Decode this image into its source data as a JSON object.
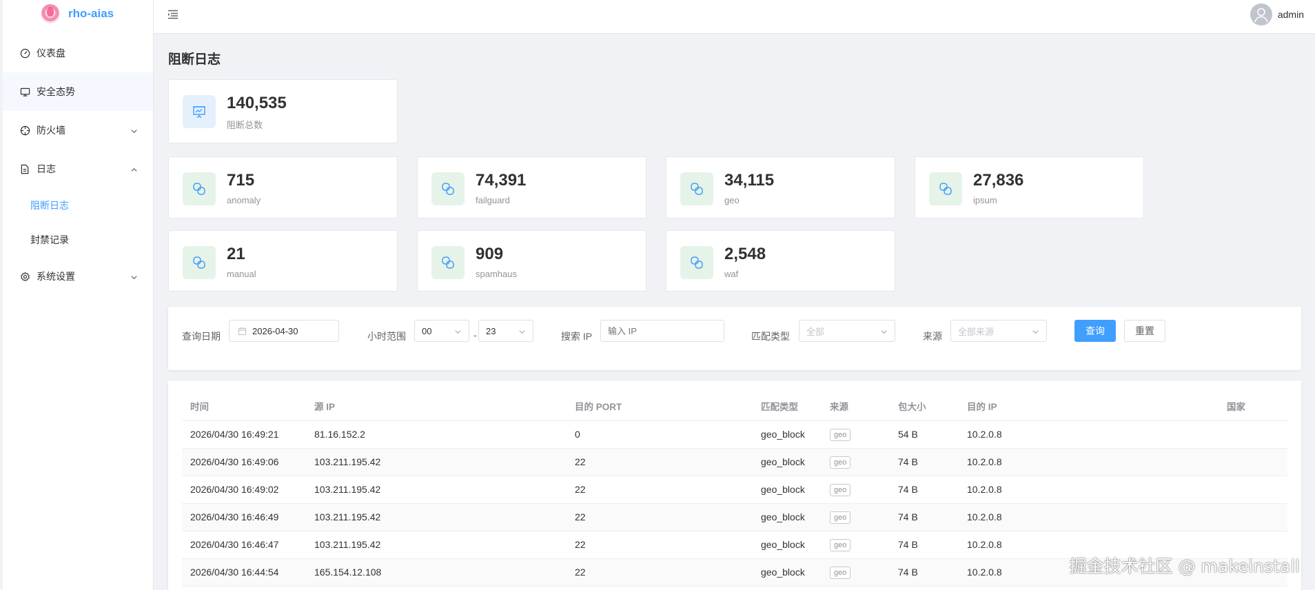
{
  "app": {
    "name": "rho-aias"
  },
  "sidebar": {
    "items": [
      {
        "label": "仪表盘",
        "icon": "dashboard-gauge-icon"
      },
      {
        "label": "安全态势",
        "icon": "monitor-icon"
      },
      {
        "label": "防火墙",
        "icon": "crosshair-icon"
      },
      {
        "label": "日志",
        "icon": "document-icon"
      },
      {
        "label": "系统设置",
        "icon": "gear-icon"
      }
    ],
    "log_children": [
      {
        "label": "阻断日志"
      },
      {
        "label": "封禁记录"
      }
    ]
  },
  "header": {
    "username": "admin"
  },
  "page": {
    "title": "阻断日志"
  },
  "stats": {
    "total": {
      "value": "140,535",
      "label": "阻断总数"
    },
    "sources": [
      {
        "value": "715",
        "label": "anomaly"
      },
      {
        "value": "74,391",
        "label": "failguard"
      },
      {
        "value": "34,115",
        "label": "geo"
      },
      {
        "value": "27,836",
        "label": "ipsum"
      },
      {
        "value": "21",
        "label": "manual"
      },
      {
        "value": "909",
        "label": "spamhaus"
      },
      {
        "value": "2,548",
        "label": "waf"
      }
    ]
  },
  "filter": {
    "date_label": "查询日期",
    "date_value": "2026-04-30",
    "hour_label": "小时范围",
    "hour_start": "00",
    "hour_sep": "-",
    "hour_end": "23",
    "ip_label": "搜索 IP",
    "ip_placeholder": "输入 IP",
    "match_label": "匹配类型",
    "match_value": "全部",
    "source_label": "来源",
    "source_value": "全部来源",
    "search_btn": "查询",
    "reset_btn": "重置"
  },
  "table": {
    "headers": [
      "时间",
      "源 IP",
      "目的 PORT",
      "匹配类型",
      "来源",
      "包大小",
      "目的 IP",
      "国家"
    ],
    "rows": [
      [
        "2026/04/30 16:49:21",
        "81.16.152.2",
        "0",
        "geo_block",
        "geo",
        "54 B",
        "10.2.0.8",
        ""
      ],
      [
        "2026/04/30 16:49:06",
        "103.211.195.42",
        "22",
        "geo_block",
        "geo",
        "74 B",
        "10.2.0.8",
        ""
      ],
      [
        "2026/04/30 16:49:02",
        "103.211.195.42",
        "22",
        "geo_block",
        "geo",
        "74 B",
        "10.2.0.8",
        ""
      ],
      [
        "2026/04/30 16:46:49",
        "103.211.195.42",
        "22",
        "geo_block",
        "geo",
        "74 B",
        "10.2.0.8",
        ""
      ],
      [
        "2026/04/30 16:46:47",
        "103.211.195.42",
        "22",
        "geo_block",
        "geo",
        "74 B",
        "10.2.0.8",
        ""
      ],
      [
        "2026/04/30 16:44:54",
        "165.154.12.108",
        "22",
        "geo_block",
        "geo",
        "74 B",
        "10.2.0.8",
        ""
      ]
    ]
  },
  "watermark": "掘金技术社区 @ makeinstall",
  "colors": {
    "accent": "#409eff",
    "stat_icon_bg": "#e6f3e8"
  }
}
